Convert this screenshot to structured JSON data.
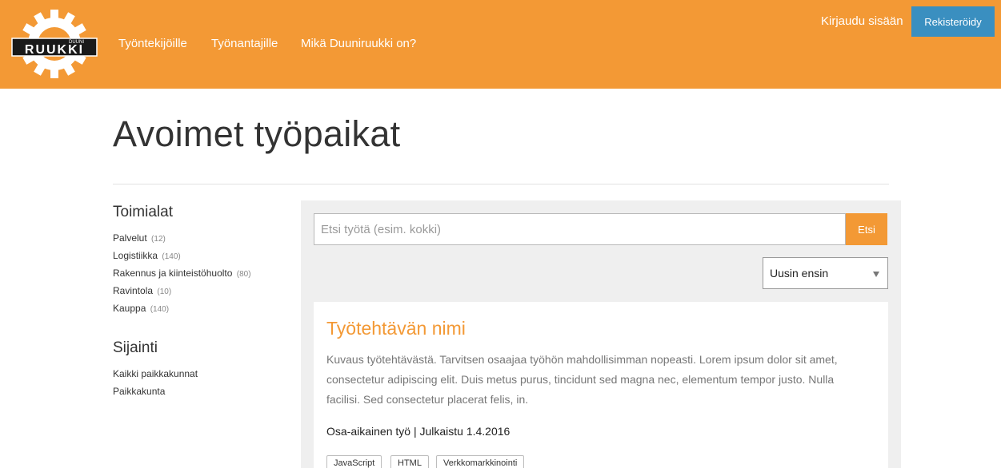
{
  "header": {
    "logo_alt": "DUUNI RUUKKI",
    "logo_text_small": "DUUNI",
    "logo_text_big": "RUUKKI",
    "nav": [
      {
        "label": "Työntekijöille"
      },
      {
        "label": "Työnantajille"
      },
      {
        "label": "Mikä Duuniruukki on?"
      }
    ],
    "login_label": "Kirjaudu sisään",
    "register_label": "Rekisteröidy"
  },
  "page": {
    "title": "Avoimet työpaikat"
  },
  "sidebar": {
    "industries_heading": "Toimialat",
    "industries": [
      {
        "label": "Palvelut",
        "count": "(12)"
      },
      {
        "label": "Logistiikka",
        "count": "(140)"
      },
      {
        "label": "Rakennus ja kiinteistöhuolto",
        "count": "(80)"
      },
      {
        "label": "Ravintola",
        "count": "(10)"
      },
      {
        "label": "Kauppa",
        "count": "(140)"
      }
    ],
    "location_heading": "Sijainti",
    "locations": [
      {
        "label": "Kaikki paikkakunnat"
      },
      {
        "label": "Paikkakunta"
      }
    ]
  },
  "search": {
    "placeholder": "Etsi työtä (esim. kokki)",
    "value": "",
    "button_label": "Etsi"
  },
  "sort": {
    "selected": "Uusin ensin"
  },
  "job": {
    "title": "Työtehtävän nimi",
    "description": "Kuvaus työtehtävästä. Tarvitsen osaajaa työhön mahdollisimman nopeasti. Lorem ipsum dolor sit amet, consectetur adipiscing elit. Duis metus purus, tincidunt sed magna nec, elementum tempor justo. Nulla facilisi. Sed consectetur placerat felis, in.",
    "meta": "Osa-aikainen työ | Julkaistu 1.4.2016",
    "tags": [
      "JavaScript",
      "HTML",
      "Verkkomarkkinointi"
    ]
  },
  "colors": {
    "brand_orange": "#f39935",
    "register_blue": "#3a8fc0",
    "panel_gray": "#efefef"
  }
}
